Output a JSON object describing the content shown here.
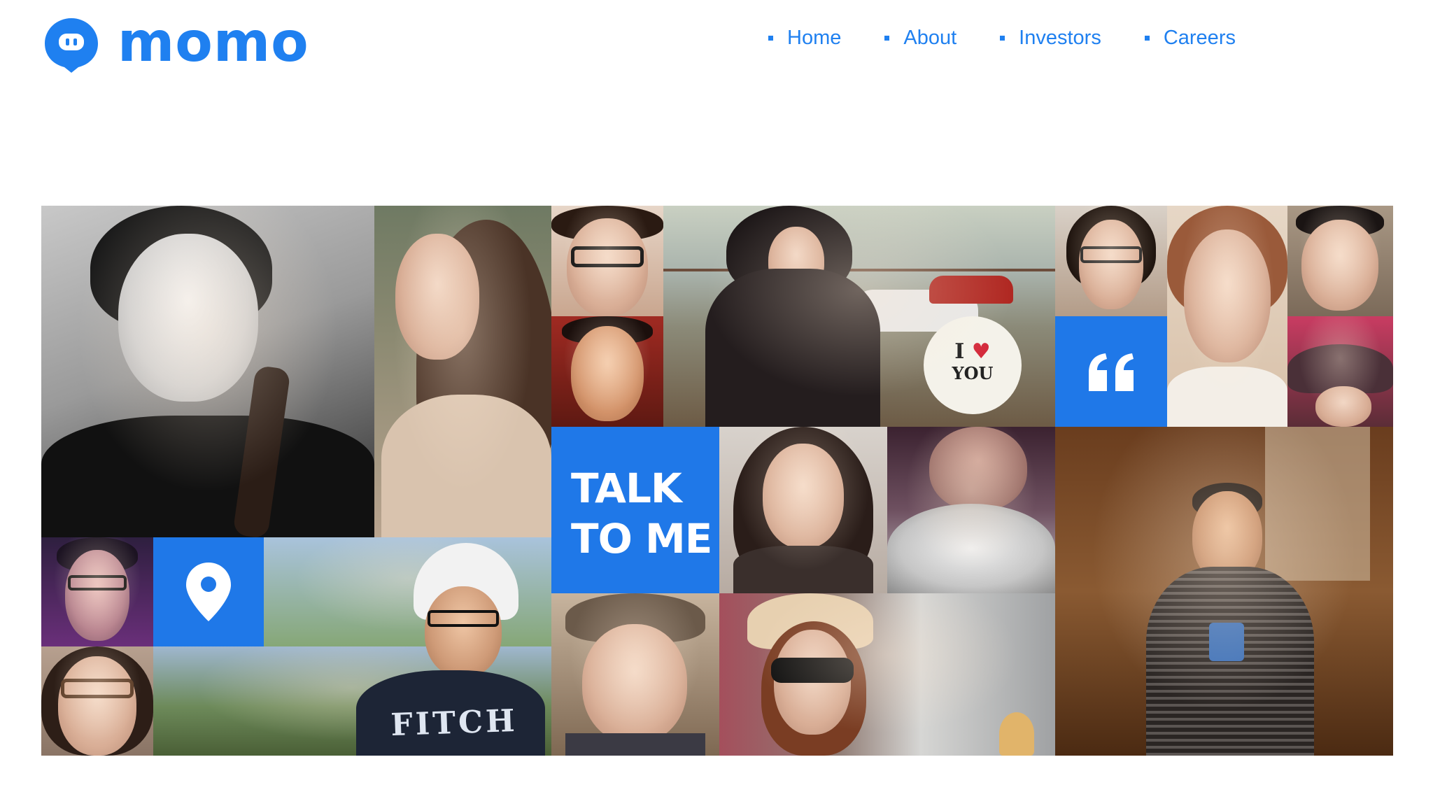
{
  "brand": {
    "name": "momo",
    "color": "#1f80f0",
    "logo_icon": "speech-bubble-icon"
  },
  "nav": {
    "items": [
      {
        "label": "Home"
      },
      {
        "label": "About"
      },
      {
        "label": "Investors"
      },
      {
        "label": "Careers"
      }
    ]
  },
  "mosaic": {
    "tile_color": "#1f78e8",
    "talk_line1": "TALK",
    "talk_line2": "TO ME",
    "location_icon": "location-pin-icon",
    "quote_icon": "quote-icon",
    "balloon_line1": "I",
    "balloon_line2": "YOU",
    "shirt_text": "FITCH"
  }
}
